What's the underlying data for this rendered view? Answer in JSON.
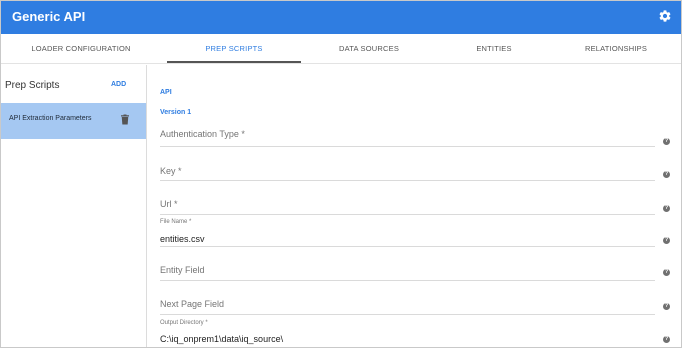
{
  "app": {
    "title": "Generic API",
    "settings_icon": "gear-icon",
    "accent_color": "#2f7de1"
  },
  "tabs": [
    {
      "label": "LOADER CONFIGURATION"
    },
    {
      "label": "PREP SCRIPTS"
    },
    {
      "label": "DATA SOURCES"
    },
    {
      "label": "ENTITIES"
    },
    {
      "label": "RELATIONSHIPS"
    }
  ],
  "active_tab": "PREP SCRIPTS",
  "sidebar": {
    "title": "Prep Scripts",
    "add_label": "ADD",
    "items": [
      {
        "label": "API Extraction Parameters",
        "icon": "trash-icon"
      }
    ]
  },
  "form": {
    "section": "API",
    "version": "Version 1",
    "fields": [
      {
        "placeholder": "Authentication Type *",
        "value": ""
      },
      {
        "placeholder": "Key *",
        "value": ""
      },
      {
        "placeholder": "Url *",
        "value": ""
      },
      {
        "label": "File Name *",
        "value": "entities.csv"
      },
      {
        "placeholder": "Entity Field",
        "value": ""
      },
      {
        "placeholder": "Next Page Field",
        "value": ""
      },
      {
        "label": "Output Directory *",
        "value": "C:\\iq_onprem1\\data\\iq_source\\"
      }
    ],
    "help_icon": "help-circle-icon"
  }
}
